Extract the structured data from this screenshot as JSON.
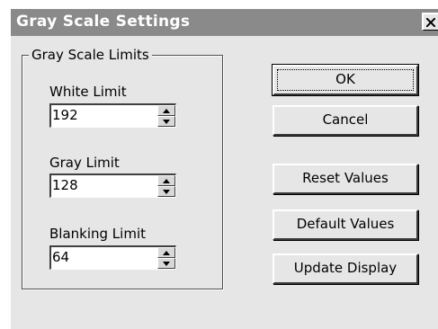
{
  "window": {
    "title": "Gray Scale Settings",
    "close_icon": "close-icon"
  },
  "group": {
    "legend": "Gray Scale Limits",
    "fields": [
      {
        "label": "White Limit",
        "value": "192"
      },
      {
        "label": "Gray Limit",
        "value": "128"
      },
      {
        "label": "Blanking Limit",
        "value": "64"
      }
    ]
  },
  "buttons": {
    "ok": "OK",
    "cancel": "Cancel",
    "reset": "Reset Values",
    "default": "Default Values",
    "update": "Update Display"
  },
  "colors": {
    "titlebar": "#8a8a8a",
    "dialog_bg": "#e6e6e6"
  }
}
